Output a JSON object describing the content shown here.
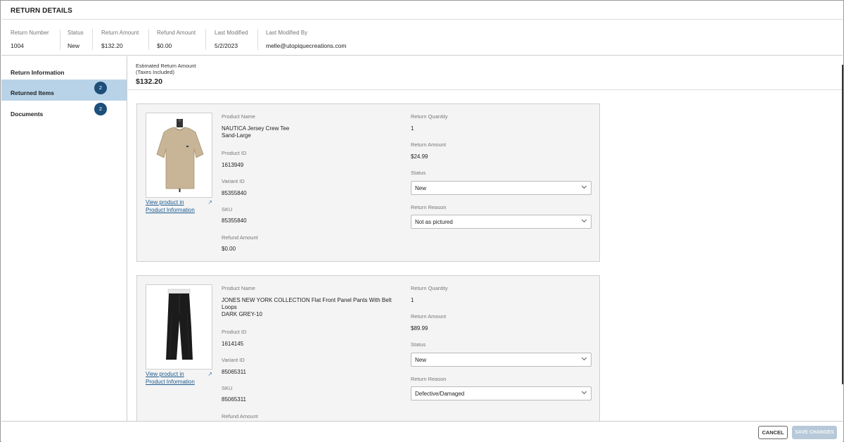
{
  "title": "RETURN DETAILS",
  "summary": [
    {
      "label": "Return Number",
      "value": "1004"
    },
    {
      "label": "Status",
      "value": "New"
    },
    {
      "label": "Return Amount",
      "value": "$132.20"
    },
    {
      "label": "Refund Amount",
      "value": "$0.00"
    },
    {
      "label": "Last Modified",
      "value": "5/2/2023"
    },
    {
      "label": "Last Modified By",
      "value": "melle@utopiquecreations.com"
    }
  ],
  "sidebar": {
    "items": [
      {
        "label": "Return Information",
        "badge": ""
      },
      {
        "label": "Returned Items",
        "badge": "2",
        "active": true
      },
      {
        "label": "Documents",
        "badge": "2"
      }
    ]
  },
  "estimate": {
    "label_line1": "Estimated Return Amount",
    "label_line2": "(Taxes Included)",
    "amount": "$132.20"
  },
  "field_labels": {
    "product_name": "Product Name",
    "product_id": "Product ID",
    "variant_id": "Variant ID",
    "sku": "SKU",
    "refund_amount": "Refund Amount",
    "return_quantity": "Return Quantity",
    "return_amount": "Return Amount",
    "status": "Status",
    "return_reason": "Return Reason"
  },
  "view_link": {
    "line1": "View product in",
    "line2": "Product Information",
    "icon": "external-link-icon"
  },
  "items": [
    {
      "product_name": "NAUTICA Jersey Crew Tee",
      "variant": "Sand-Large",
      "product_id": "1613949",
      "variant_id": "85355840",
      "sku": "85355840",
      "refund_amount": "$0.00",
      "return_quantity": "1",
      "return_amount": "$24.99",
      "status": "New",
      "return_reason": "Not as pictured",
      "image_icon": "tshirt-image"
    },
    {
      "product_name": "JONES NEW YORK COLLECTION Flat Front Panel Pants With Belt Loops",
      "variant": "DARK GREY-10",
      "product_id": "1614145",
      "variant_id": "85065311",
      "sku": "85065311",
      "refund_amount": "",
      "return_quantity": "1",
      "return_amount": "$89.99",
      "status": "New",
      "return_reason": "Defective/Damaged",
      "image_icon": "pants-image"
    }
  ],
  "footer": {
    "cancel": "CANCEL",
    "save": "SAVE CHANGES"
  },
  "colors": {
    "accent": "#1c4f7a",
    "active_nav": "#b8d3e8",
    "link": "#1c5a8f",
    "save_disabled": "#b7c9d8"
  }
}
